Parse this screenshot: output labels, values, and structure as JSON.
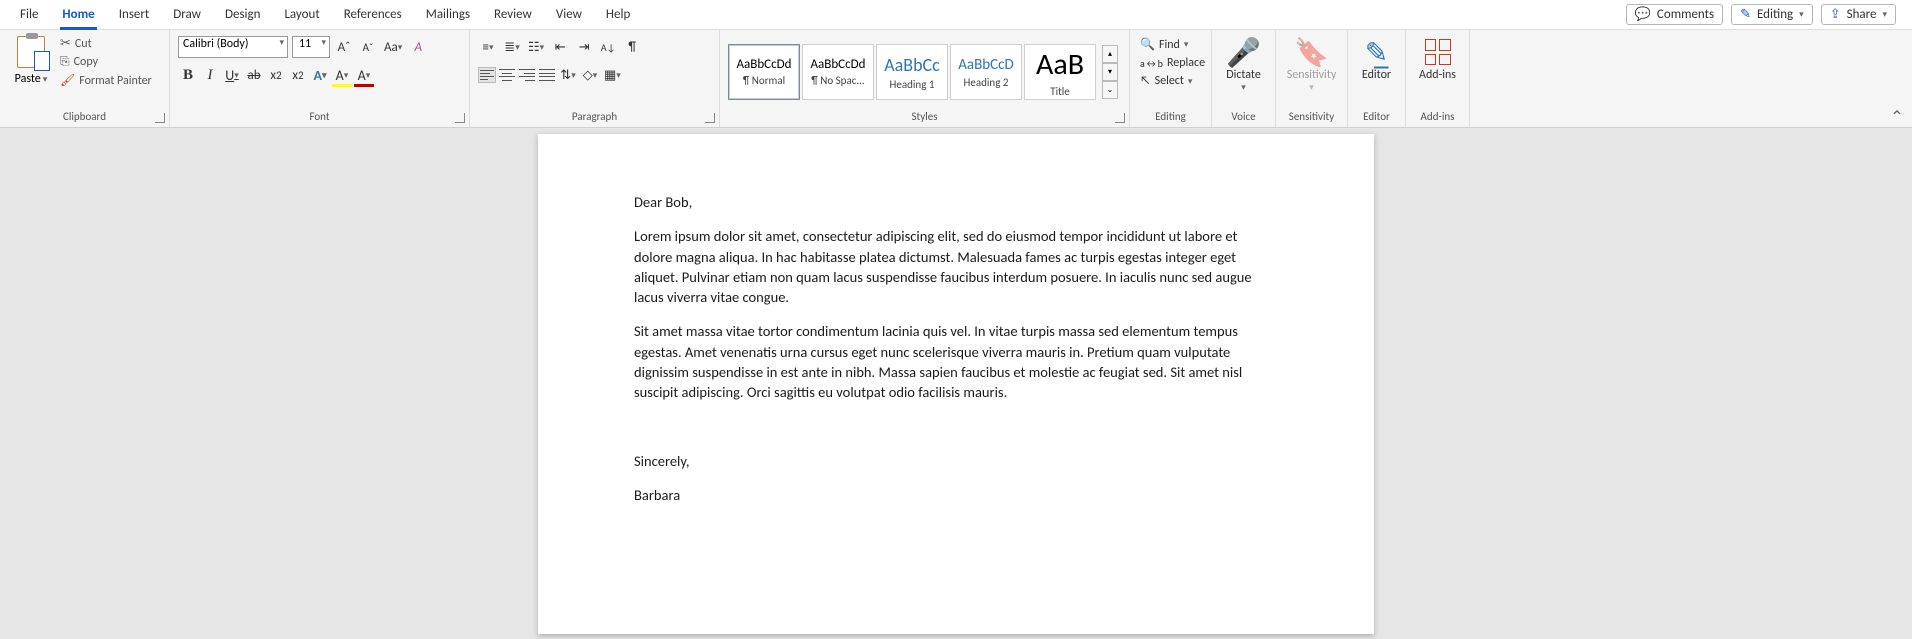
{
  "tabs": {
    "file": "File",
    "home": "Home",
    "insert": "Insert",
    "draw": "Draw",
    "design": "Design",
    "layout": "Layout",
    "references": "References",
    "mailings": "Mailings",
    "review": "Review",
    "view": "View",
    "help": "Help"
  },
  "topright": {
    "comments": "Comments",
    "editing": "Editing",
    "share": "Share"
  },
  "clipboard": {
    "paste": "Paste",
    "cut": "Cut",
    "copy": "Copy",
    "format_painter": "Format Painter",
    "label": "Clipboard"
  },
  "font": {
    "name": "Calibri (Body)",
    "size": "11",
    "grow": "A",
    "shrink": "A",
    "case": "Aa",
    "clear": "A",
    "bold": "B",
    "italic": "I",
    "underline": "U",
    "strike": "ab",
    "sub": "x",
    "sub2": "2",
    "sup": "x",
    "sup2": "2",
    "effects": "A",
    "highlight": "A",
    "color": "A",
    "label": "Font"
  },
  "paragraph": {
    "sort": "A↓",
    "pilcrow": "¶",
    "label": "Paragraph"
  },
  "styles": {
    "items": [
      {
        "preview": "AaBbCcDd",
        "name": "¶ Normal",
        "blue": false,
        "size": "13px",
        "selected": true
      },
      {
        "preview": "AaBbCcDd",
        "name": "¶ No Spac...",
        "blue": false,
        "size": "13px",
        "selected": false
      },
      {
        "preview": "AaBbCc",
        "name": "Heading 1",
        "blue": true,
        "size": "18px",
        "selected": false
      },
      {
        "preview": "AaBbCcD",
        "name": "Heading 2",
        "blue": true,
        "size": "15px",
        "selected": false
      },
      {
        "preview": "AaB",
        "name": "Title",
        "blue": false,
        "size": "30px",
        "selected": false
      }
    ],
    "label": "Styles"
  },
  "editing": {
    "find": "Find",
    "replace": "Replace",
    "select": "Select",
    "label": "Editing"
  },
  "voice": {
    "dictate": "Dictate",
    "label": "Voice"
  },
  "sensitivity": {
    "btn": "Sensitivity",
    "label": "Sensitivity"
  },
  "editor": {
    "btn": "Editor",
    "label": "Editor"
  },
  "addins": {
    "btn": "Add-ins",
    "label": "Add-ins"
  },
  "document": {
    "greeting": "Dear Bob,",
    "p1": "Lorem ipsum dolor sit amet, consectetur adipiscing elit, sed do eiusmod tempor incididunt ut labore et dolore magna aliqua. In hac habitasse platea dictumst. Malesuada fames ac turpis egestas integer eget aliquet. Pulvinar etiam non quam lacus suspendisse faucibus interdum posuere. In iaculis nunc sed augue lacus viverra vitae congue.",
    "p2": "Sit amet massa vitae tortor condimentum lacinia quis vel. In vitae turpis massa sed elementum tempus egestas. Amet venenatis urna cursus eget nunc scelerisque viverra mauris in. Pretium quam vulputate dignissim suspendisse in est ante in nibh. Massa sapien faucibus et molestie ac feugiat sed. Sit amet nisl suscipit adipiscing. Orci sagittis eu volutpat odio facilisis mauris.",
    "blank": " ",
    "closing": "Sincerely,",
    "signature": "Barbara"
  }
}
